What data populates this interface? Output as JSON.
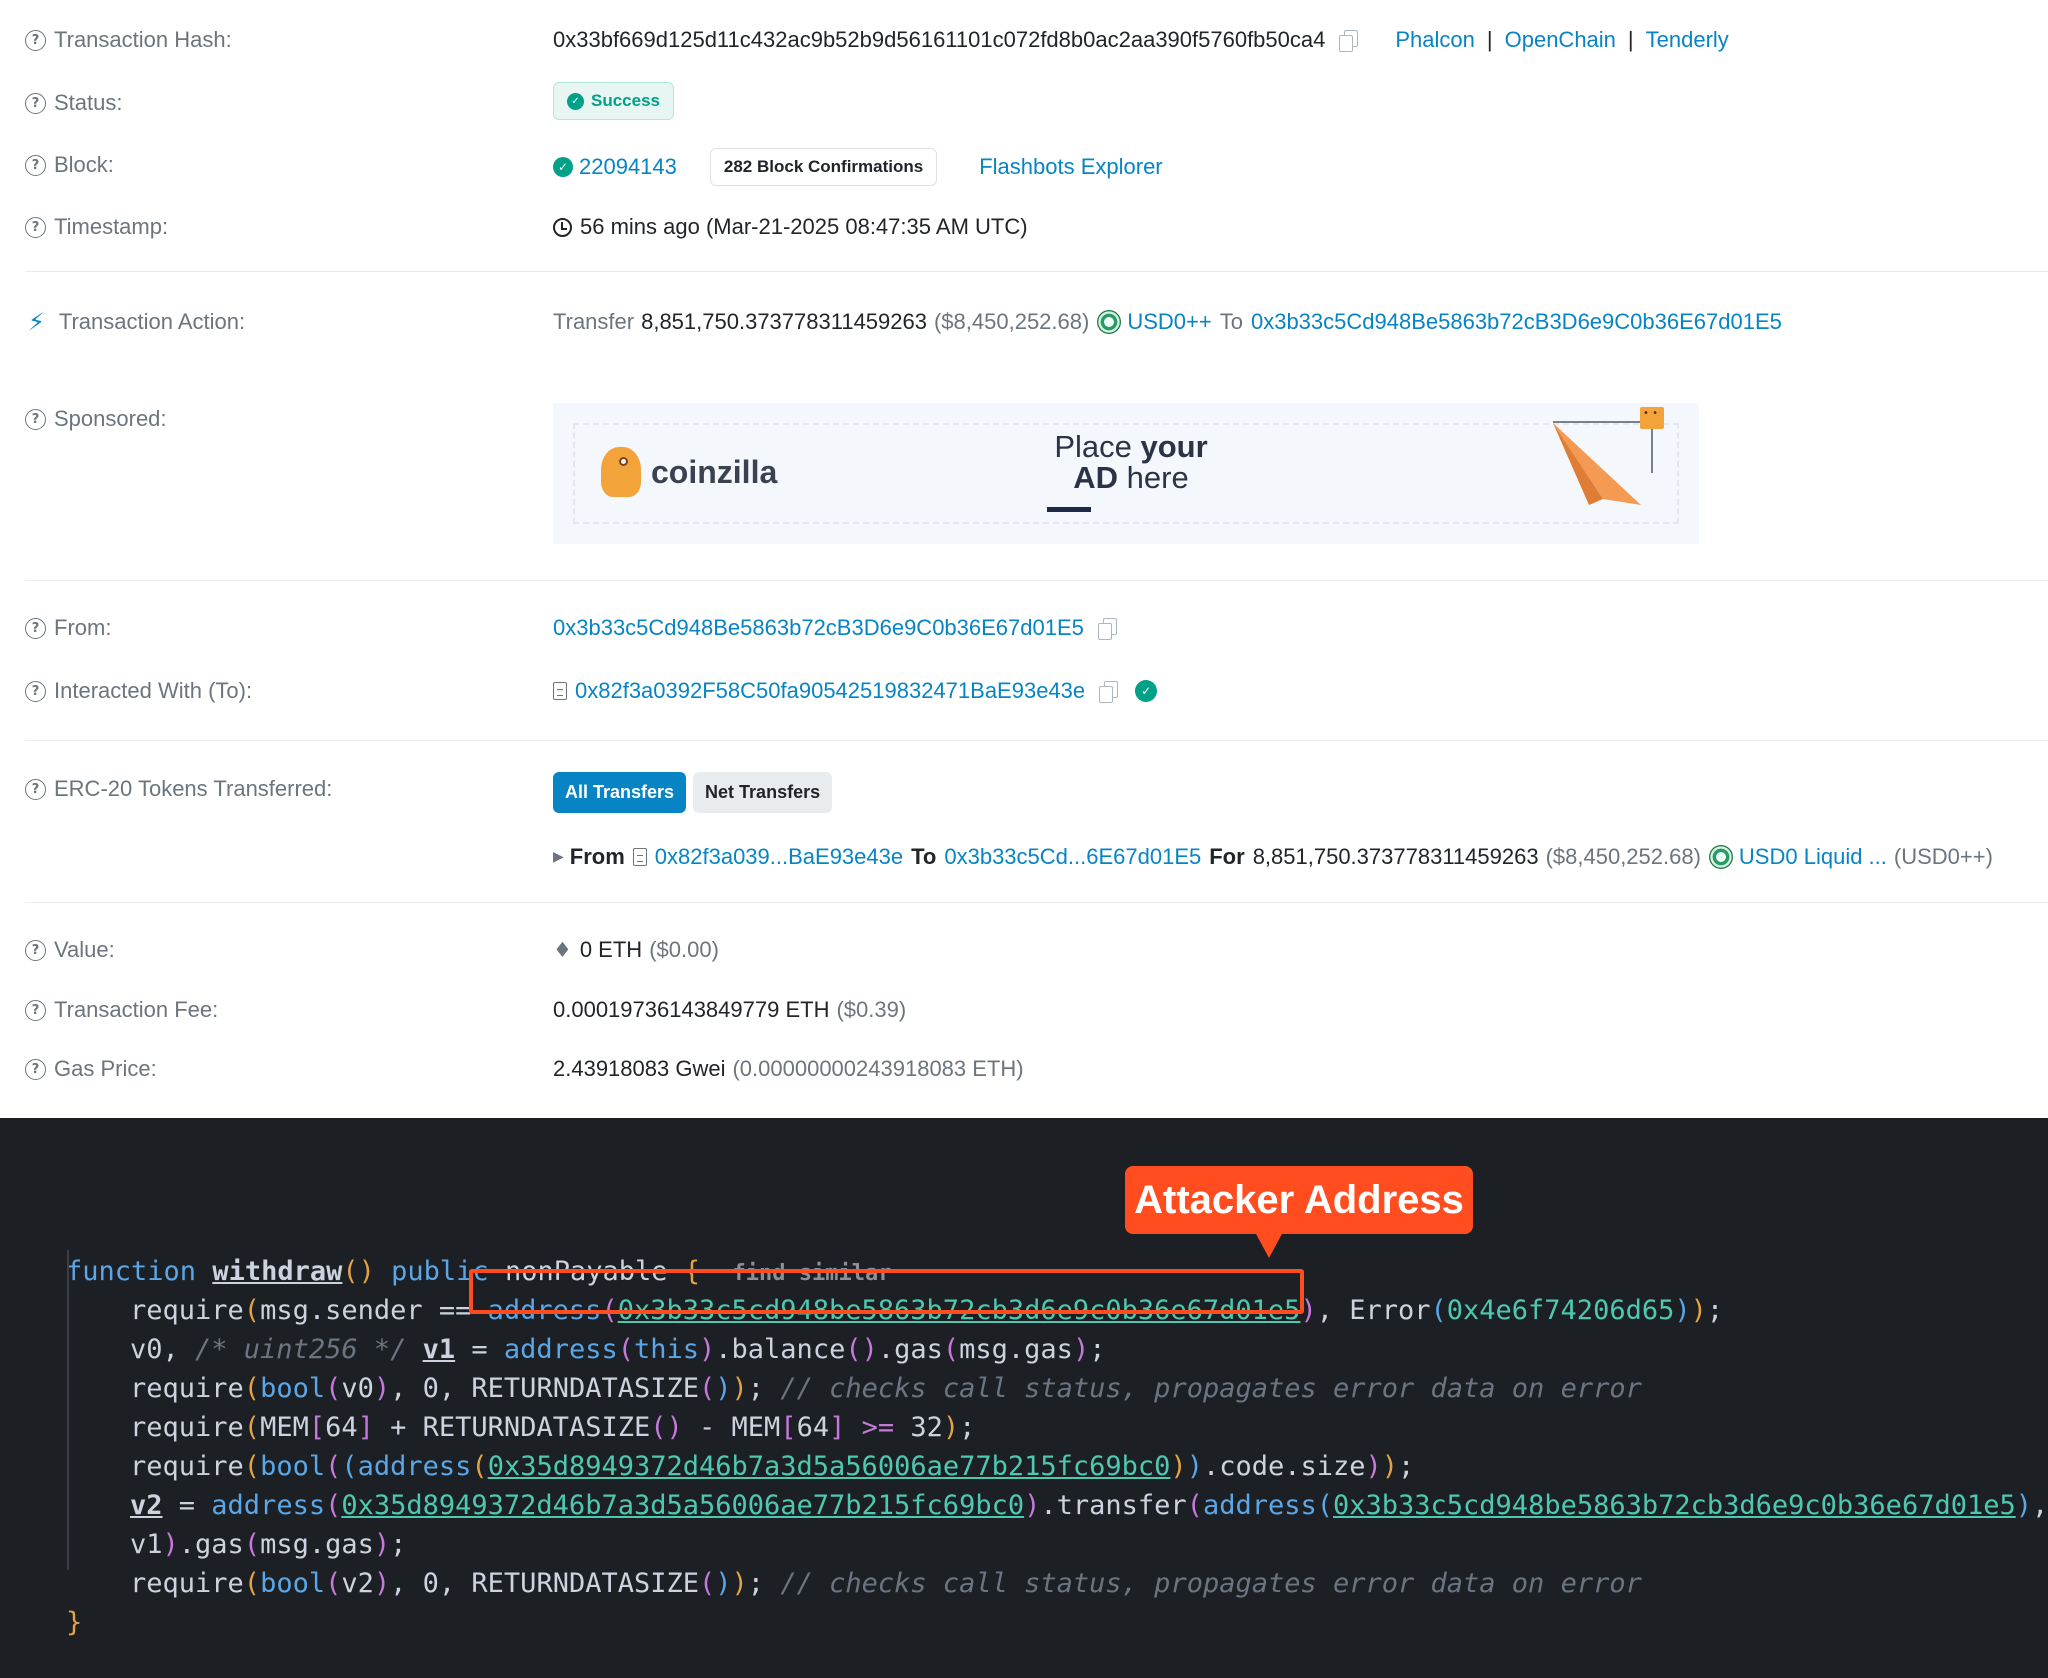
{
  "rows": {
    "tx_hash": {
      "label": "Transaction Hash:",
      "value": "0x33bf669d125d11c432ac9b52b9d56161101c072fd8b0ac2aa390f5760fb50ca4",
      "links": [
        "Phalcon",
        "OpenChain",
        "Tenderly"
      ],
      "sep": "|"
    },
    "status": {
      "label": "Status:",
      "value": "Success"
    },
    "block": {
      "label": "Block:",
      "number": "22094143",
      "confirmations": "282 Block Confirmations",
      "explorer_link": "Flashbots Explorer"
    },
    "timestamp": {
      "label": "Timestamp:",
      "value": "56 mins ago (Mar-21-2025 08:47:35 AM UTC)"
    },
    "action": {
      "label": "Transaction Action:",
      "verb": "Transfer",
      "amount": "8,851,750.373778311459263",
      "usd": "($8,450,252.68)",
      "token": "USD0++",
      "to_word": "To",
      "to_address": "0x3b33c5Cd948Be5863b72cB3D6e9C0b36E67d01E5"
    },
    "sponsored": {
      "label": "Sponsored:",
      "brand": "coinzilla",
      "cta_line1_a": "Place ",
      "cta_line1_b": "your",
      "cta_line2_a": "AD",
      "cta_line2_b": " here"
    },
    "from": {
      "label": "From:",
      "value": "0x3b33c5Cd948Be5863b72cB3D6e9C0b36E67d01E5"
    },
    "to": {
      "label": "Interacted With (To):",
      "value": "0x82f3a0392F58C50fa90542519832471BaE93e43e"
    },
    "erc20": {
      "label": "ERC-20 Tokens Transferred:",
      "tab_all": "All Transfers",
      "tab_net": "Net Transfers",
      "from_word": "From",
      "from_addr": "0x82f3a039...BaE93e43e",
      "to_word": "To",
      "to_addr": "0x3b33c5Cd...6E67d01E5",
      "for_word": "For",
      "amount": "8,851,750.373778311459263",
      "usd": "($8,450,252.68)",
      "token_name": "USD0 Liquid ...",
      "token_symbol": "(USD0++)"
    },
    "value": {
      "label": "Value:",
      "amount": "0 ETH",
      "usd": "($0.00)"
    },
    "fee": {
      "label": "Transaction Fee:",
      "amount": "0.00019736143849779 ETH",
      "usd": "($0.39)"
    },
    "gas": {
      "label": "Gas Price:",
      "amount": "2.43918083 Gwei",
      "eth": "(0.00000000243918083 ETH)"
    }
  },
  "code": {
    "callout": "Attacker Address",
    "find_similar": "find similar",
    "attacker": "0x3b33c5cd948be5863b72cb3d6e9c0b36e67d01e5",
    "token_contract": "0x35d8949372d46b7a3d5a56006ae77b215fc69bc0",
    "error_code": "0x4e6f74206d65",
    "comment": "// checks call status, propagates error data on error"
  },
  "colors": {
    "link": "#0784c3",
    "success": "#00a186",
    "code_bg": "#1c2024",
    "highlight": "#ff4d1f"
  },
  "icons": [
    "question-circle-icon",
    "copy-icon",
    "check-circle-icon",
    "clock-icon",
    "lightning-icon",
    "document-icon",
    "ethereum-icon",
    "caret-right-icon",
    "usd0-token-icon"
  ]
}
